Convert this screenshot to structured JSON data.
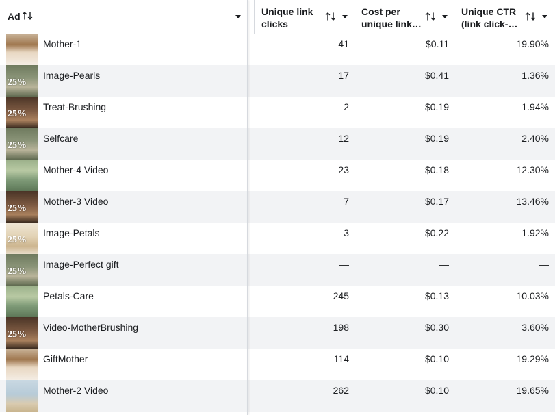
{
  "header": {
    "ad_label": "Ad",
    "col1": [
      "Unique link",
      "clicks"
    ],
    "col2": [
      "Cost per",
      "unique link…"
    ],
    "col3": [
      "Unique CTR",
      "(link click-…"
    ]
  },
  "thumb_text": "25%",
  "rows": [
    {
      "name": "Mother-1",
      "clicks": "41",
      "cost": "$0.11",
      "ctr": "19.90%",
      "thumb": "mother-portrait"
    },
    {
      "name": "Image-Pearls",
      "clicks": "17",
      "cost": "$0.41",
      "ctr": "1.36%",
      "thumb": "green-promo"
    },
    {
      "name": "Treat-Brushing",
      "clicks": "2",
      "cost": "$0.19",
      "ctr": "1.94%",
      "thumb": "brown-promo"
    },
    {
      "name": "Selfcare",
      "clicks": "12",
      "cost": "$0.19",
      "ctr": "2.40%",
      "thumb": "green-promo"
    },
    {
      "name": "Mother-4 Video",
      "clicks": "23",
      "cost": "$0.18",
      "ctr": "12.30%",
      "thumb": "mint-video"
    },
    {
      "name": "Mother-3 Video",
      "clicks": "7",
      "cost": "$0.17",
      "ctr": "13.46%",
      "thumb": "brown-promo"
    },
    {
      "name": "Image-Petals",
      "clicks": "3",
      "cost": "$0.22",
      "ctr": "1.92%",
      "thumb": "light-promo"
    },
    {
      "name": "Image-Perfect gift",
      "clicks": "—",
      "cost": "—",
      "ctr": "—",
      "thumb": "green-promo"
    },
    {
      "name": "Petals-Care",
      "clicks": "245",
      "cost": "$0.13",
      "ctr": "10.03%",
      "thumb": "mint-video"
    },
    {
      "name": "Video-MotherBrushing",
      "clicks": "198",
      "cost": "$0.30",
      "ctr": "3.60%",
      "thumb": "brown-promo"
    },
    {
      "name": "GiftMother",
      "clicks": "114",
      "cost": "$0.10",
      "ctr": "19.29%",
      "thumb": "mother-portrait"
    },
    {
      "name": "Mother-2 Video",
      "clicks": "262",
      "cost": "$0.10",
      "ctr": "19.65%",
      "thumb": "beach-scene"
    }
  ],
  "colors": {
    "alt_row": "#f2f3f5",
    "text": "#1c1e21",
    "border": "#d6d9de"
  }
}
